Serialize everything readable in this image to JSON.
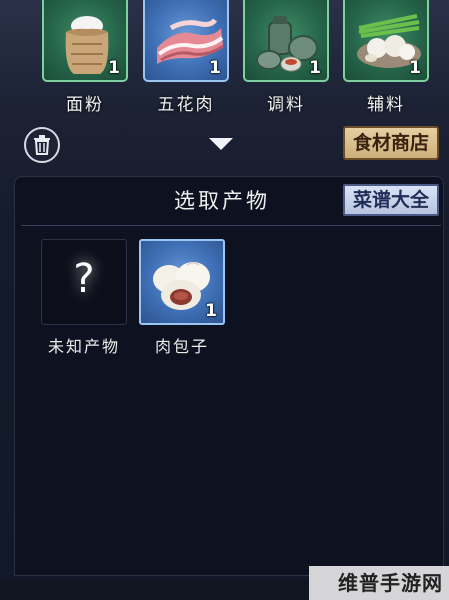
{
  "ingredients": [
    {
      "name": "面粉",
      "count": "1",
      "icon": "flour-sack-icon",
      "highlight": "green"
    },
    {
      "name": "五花肉",
      "count": "1",
      "icon": "pork-belly-icon",
      "highlight": "blue"
    },
    {
      "name": "调料",
      "count": "1",
      "icon": "seasoning-jars-icon",
      "highlight": "green"
    },
    {
      "name": "辅料",
      "count": "1",
      "icon": "scallion-garlic-icon",
      "highlight": "green"
    }
  ],
  "toolbar": {
    "trash_icon": "trash-icon",
    "collapse_icon": "chevron-down-icon",
    "shop_label": "食材商店"
  },
  "panel": {
    "title": "选取产物",
    "recipe_label": "菜谱大全",
    "products": [
      {
        "name": "未知产物",
        "symbol": "?",
        "icon": "question-mark-icon"
      },
      {
        "name": "肉包子",
        "count": "1",
        "icon": "steamed-bun-icon"
      }
    ]
  },
  "watermark": "维普手游网",
  "colors": {
    "green_frame": "#7ed0a0",
    "blue_frame": "#9cc6f2",
    "shop_button": "#cdb07a",
    "recipe_button": "#b8c4e0"
  }
}
